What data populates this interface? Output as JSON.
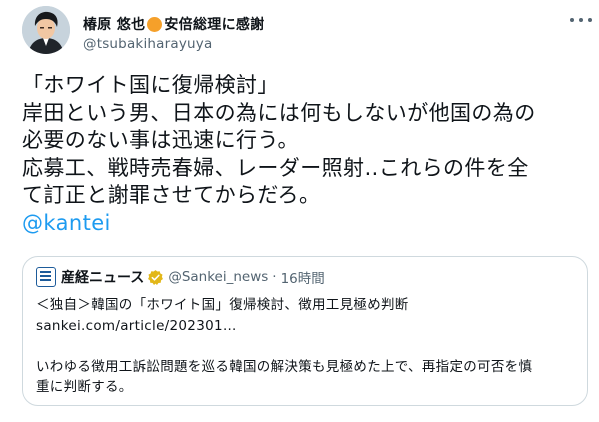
{
  "author": {
    "display_name_part1": "椿原 悠也",
    "display_name_part2": "安倍総理に感謝",
    "handle": "@tsubakiharayuya",
    "avatar_icon": "profile-avatar-illustration",
    "status_dot_color": "#f5a02a"
  },
  "tweet": {
    "lines": [
      "「ホワイト国に復帰検討」",
      "岸田という男、日本の為には何もしないが他国の為の",
      "必要のない事は迅速に行う。",
      "応募工、戦時売春婦、レーダー照射‥これらの件を全",
      "て訂正と謝罪させてからだろ。"
    ],
    "mention": "@kantei"
  },
  "quoted": {
    "source_name": "産経ニュース",
    "verified_icon": "gold-verified-badge",
    "handle": "@Sankei_news",
    "separator": "·",
    "time": "16時間",
    "line1": "＜独自＞韓国の「ホワイト国」復帰検討、徴用工見極め判断",
    "link": "sankei.com/article/202301…",
    "line2": "いわゆる徴用工訴訟問題を巡る韓国の解決策も見極めた上で、再指定の可否を慎",
    "line3": "重に判断する。"
  },
  "colors": {
    "link": "#1d9bf0",
    "secondary_text": "#536471",
    "border": "#cfd9de",
    "verified_gold": "#e2b719"
  }
}
